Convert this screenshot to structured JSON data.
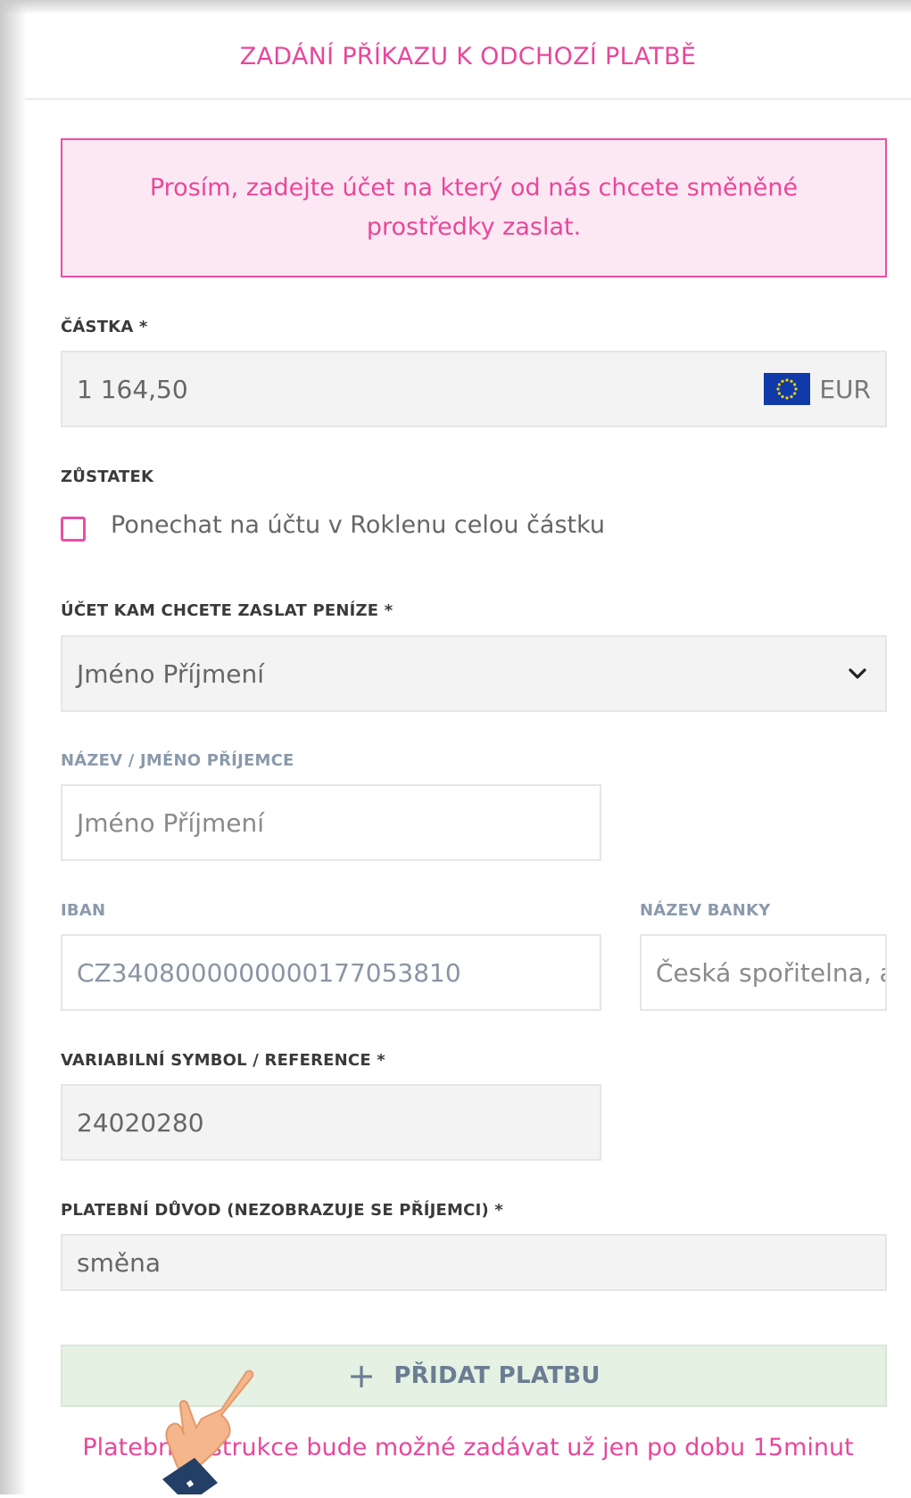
{
  "header": {
    "title": "ZADÁNÍ PŘÍKAZU K ODCHOZÍ PLATBĚ"
  },
  "notice": {
    "text": "Prosím, zadejte účet na který od nás chcete směněné prostředky zaslat."
  },
  "amount": {
    "label": "ČÁSTKA *",
    "value": "1 164,50",
    "currency": "EUR",
    "currency_icon": "eu-flag-icon"
  },
  "balance": {
    "label": "ZŮSTATEK",
    "checkbox_label": "Ponechat na účtu v Roklenu celou částku",
    "checked": false
  },
  "account": {
    "label": "ÚČET KAM CHCETE ZASLAT PENÍZE *",
    "selected": "Jméno Příjmení"
  },
  "recipient": {
    "label": "NÁZEV / JMÉNO PŘÍJEMCE",
    "value": "Jméno Příjmení"
  },
  "iban": {
    "label": "IBAN",
    "value": "CZ3408000000000177053810"
  },
  "bank": {
    "label": "NÁZEV BANKY",
    "value": "Česká spořitelna, a.s."
  },
  "reference": {
    "label": "VARIABILNÍ SYMBOL / REFERENCE *",
    "value": "24020280"
  },
  "reason": {
    "label": "PLATEBNÍ DŮVOD (NEZOBRAZUJE SE PŘÍJEMCI) *",
    "value": "směna"
  },
  "add_button": {
    "label": "PŘIDAT PLATBU"
  },
  "footer": {
    "note": "Platební instrukce bude možné zadávat už jen po dobu 15minut"
  },
  "colors": {
    "accent": "#e8479b",
    "notice_bg": "#fce8f3",
    "button_bg": "#e4f1e3",
    "eu_blue": "#0f3aa8"
  }
}
